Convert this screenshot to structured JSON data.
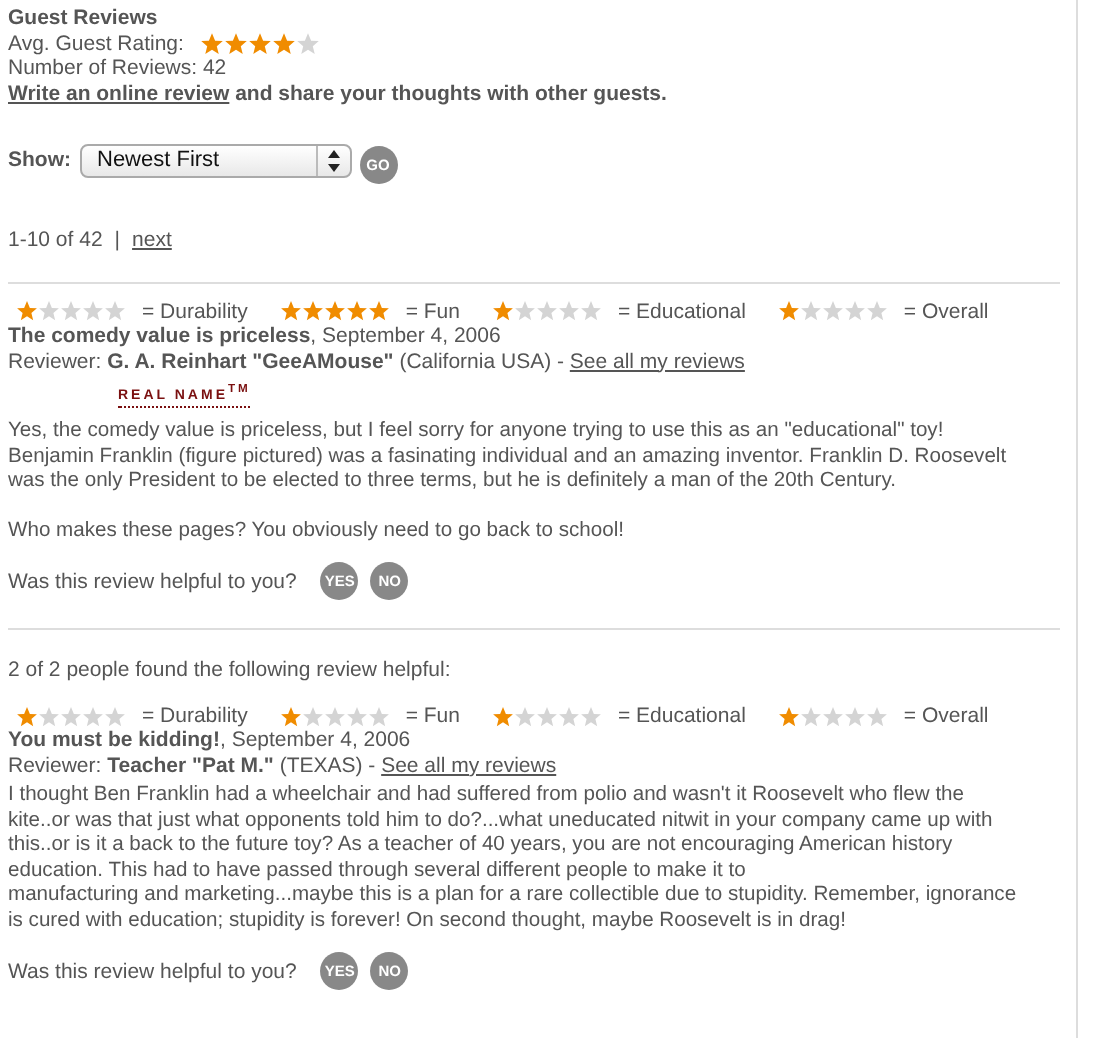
{
  "header": {
    "title": "Guest Reviews",
    "avg_label": "Avg. Guest Rating:",
    "avg_rating": {
      "stars": 4
    },
    "count_text": "Number of Reviews: 42",
    "write_link": "Write an online review",
    "write_rest": " and share your thoughts with other guests."
  },
  "sort": {
    "label": "Show:",
    "value": "Newest First",
    "go": "GO"
  },
  "pagination": {
    "range": "1-10 of 42",
    "separator": "|",
    "next": "next"
  },
  "reviews": [
    {
      "ratings": [
        {
          "stars": 1,
          "label": "= Durability"
        },
        {
          "stars": 5,
          "label": "= Fun"
        },
        {
          "stars": 1,
          "label": "= Educational"
        },
        {
          "stars": 1,
          "label": "= Overall"
        }
      ],
      "title": "The comedy value is priceless",
      "date": ", September 4, 2006",
      "reviewer_label": "Reviewer: ",
      "reviewer": "G. A. Reinhart \"GeeAMouse\"",
      "location": " (California USA) - ",
      "see_all": "See all my reviews",
      "real_name": "REAL NAME$^{TM}$",
      "paragraphs": [
        [
          "Yes, the comedy value is priceless, but I feel sorry for anyone trying to use this as an \"educational\" toy!",
          "Benjamin Franklin (figure pictured) was a fasinating individual and an amazing inventor. Franklin D. Roosevelt",
          "was the only President to be elected to three terms, but he is definitely a man of the 20th Century."
        ],
        [
          "Who makes these pages? You obviously need to go back to school!"
        ]
      ],
      "helpful_q": "Was this review helpful to you?",
      "yes": "YES",
      "no": "NO"
    },
    {
      "helpful_note": "2 of 2 people found the following review helpful:",
      "ratings": [
        {
          "stars": 1,
          "label": "= Durability"
        },
        {
          "stars": 1,
          "label": "= Fun"
        },
        {
          "stars": 1,
          "label": "= Educational"
        },
        {
          "stars": 1,
          "label": "= Overall"
        }
      ],
      "title": "You must be kidding!",
      "date": ", September 4, 2006",
      "reviewer_label": "Reviewer: ",
      "reviewer": "Teacher \"Pat M.\"",
      "location": " (TEXAS) - ",
      "see_all": "See all my reviews",
      "paragraphs": [
        [
          "I thought Ben Franklin had a wheelchair and had suffered from polio and wasn't it Roosevelt who flew the",
          "kite..or was that just what opponents told him to do?...what uneducated nitwit in your company came up with",
          "this..or is it a back to the future toy? As a teacher of 40 years, you are not encouraging American history",
          "education. This had to have passed through several different people to make it to",
          "manufacturing and marketing...maybe this is a plan for a rare collectible due to stupidity. Remember, ignorance",
          "is cured with education; stupidity is forever! On second thought, maybe Roosevelt is in drag!"
        ]
      ],
      "helpful_q": "Was this review helpful to you?",
      "yes": "YES",
      "no": "NO"
    }
  ]
}
